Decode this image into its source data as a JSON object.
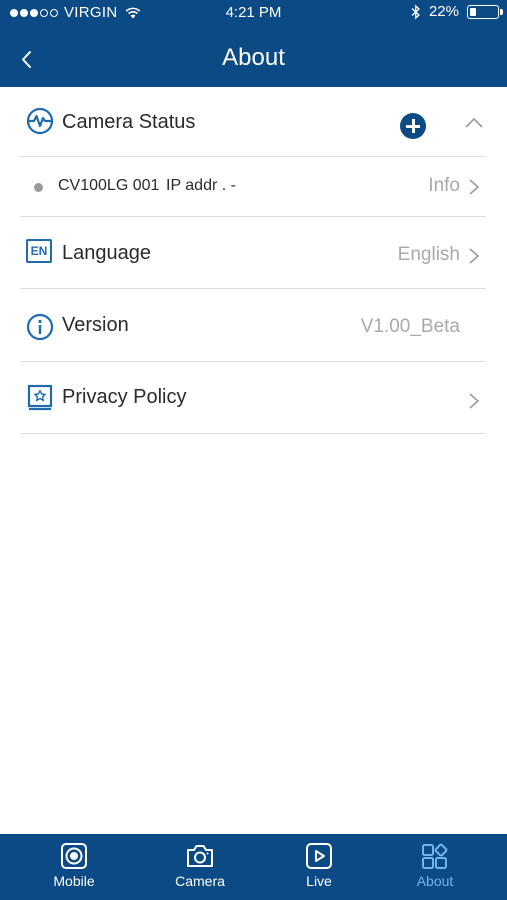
{
  "status_bar": {
    "carrier": "VIRGIN",
    "time": "4:21 PM",
    "battery_percent": "22%",
    "battery_level": 0.22,
    "signal_bars_filled": 3,
    "signal_bars_total": 5
  },
  "nav": {
    "title": "About"
  },
  "camera_status": {
    "label": "Camera Status",
    "cameras": [
      {
        "name": "CV100LG 001",
        "ip": "IP addr . -",
        "action": "Info"
      }
    ]
  },
  "language": {
    "label": "Language",
    "badge": "EN",
    "value": "English"
  },
  "version": {
    "label": "Version",
    "value": "V1.00_Beta"
  },
  "privacy": {
    "label": "Privacy Policy"
  },
  "tabs": [
    {
      "label": "Mobile",
      "icon": "mobile-icon"
    },
    {
      "label": "Camera",
      "icon": "camera-icon"
    },
    {
      "label": "Live",
      "icon": "live-icon"
    },
    {
      "label": "About",
      "icon": "about-icon",
      "active": true
    }
  ],
  "colors": {
    "header": "#0b4a85",
    "accent": "#1e6bb0",
    "active_tab": "#6fb5ee",
    "secondary_text": "#a9a9a9"
  }
}
